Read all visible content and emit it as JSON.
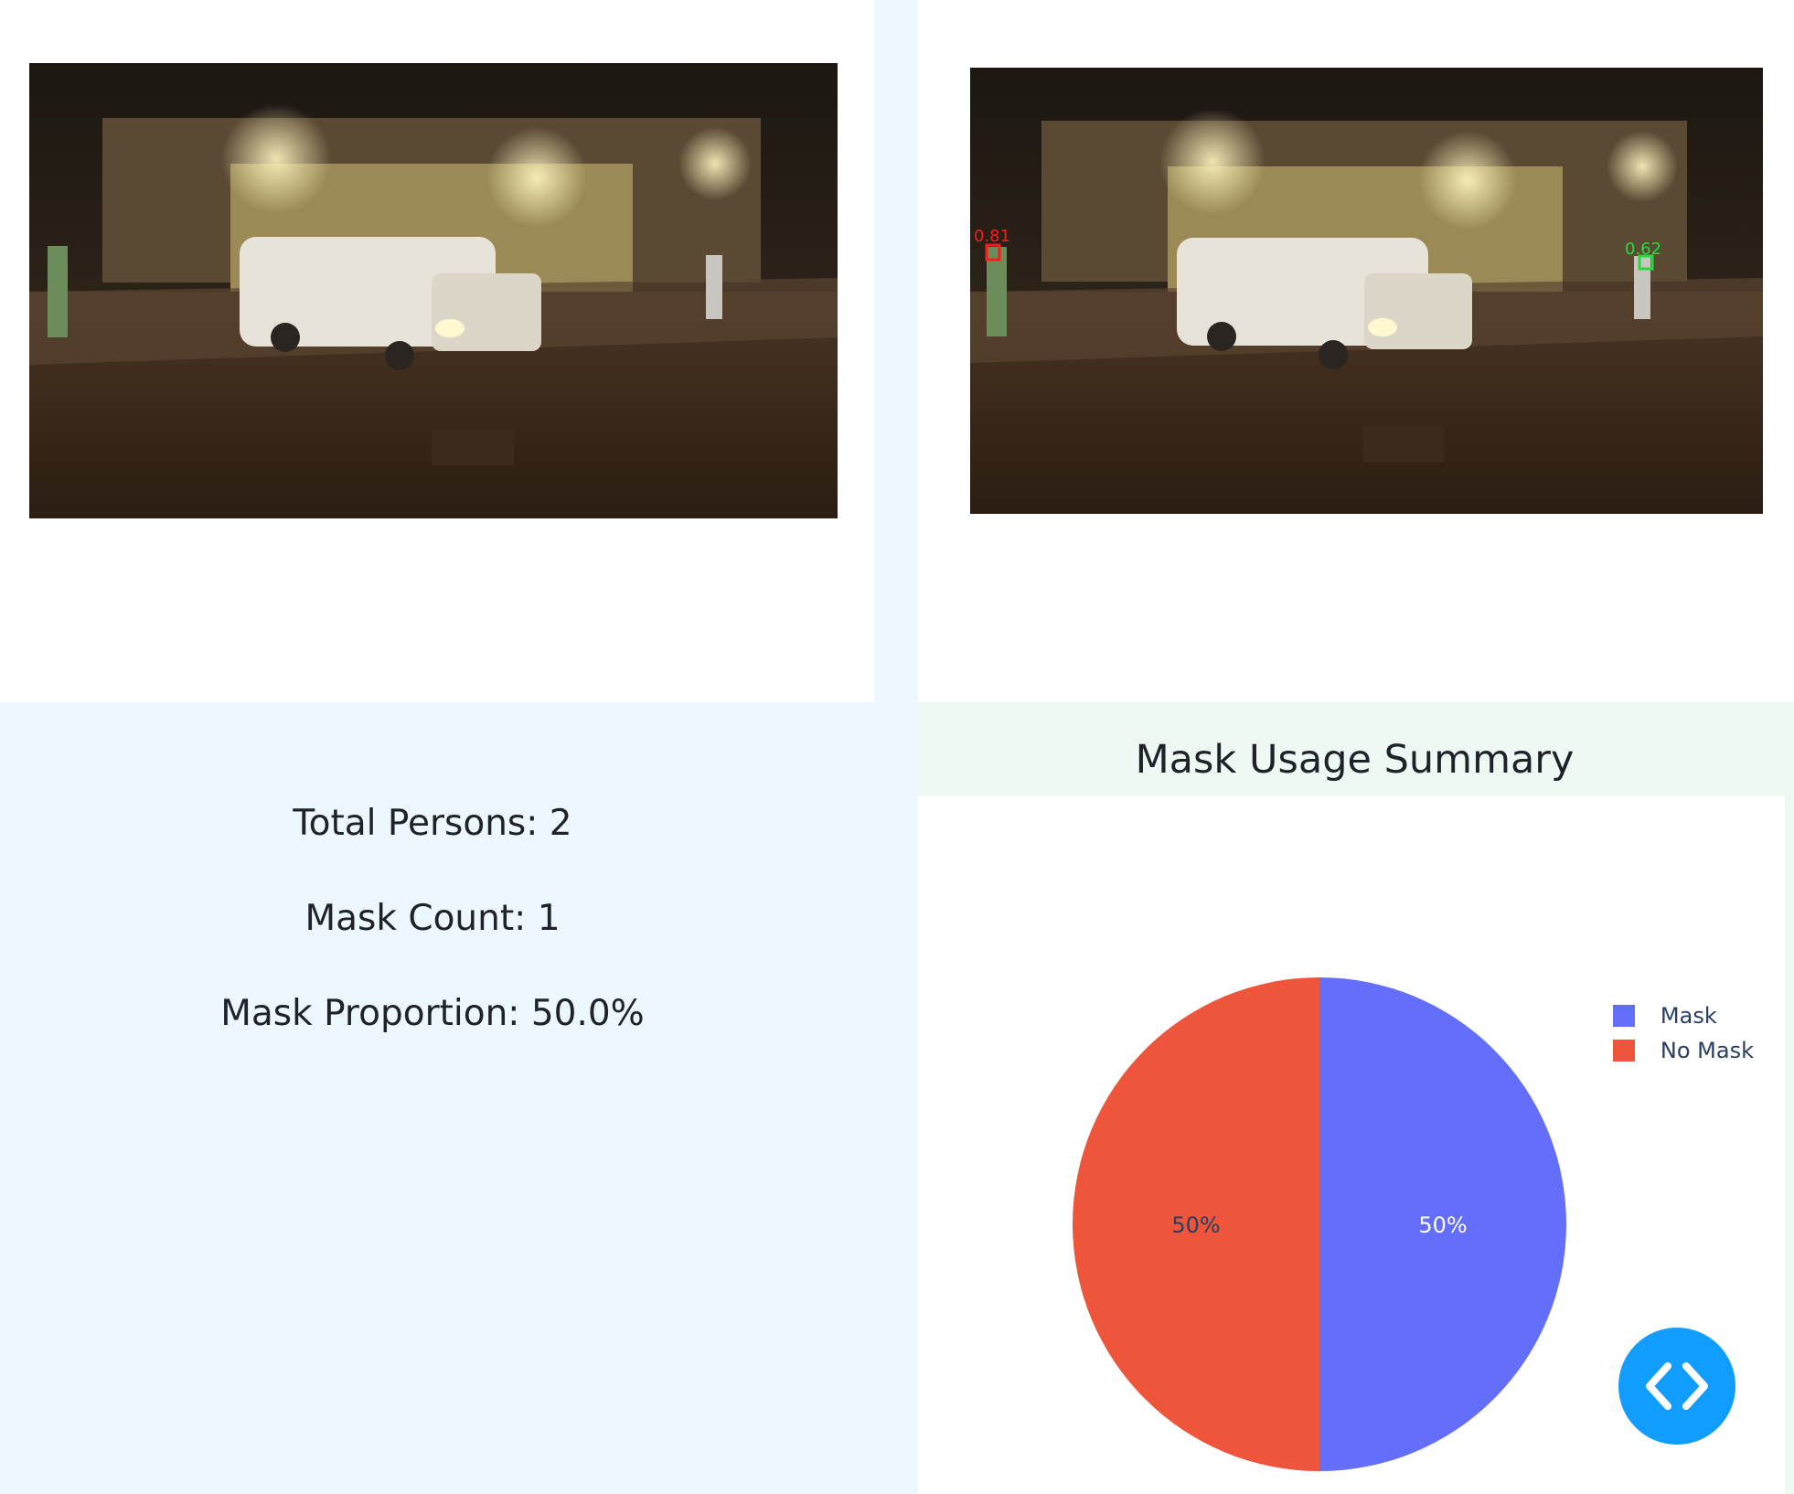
{
  "images": {
    "original": {
      "alt": "street-scene"
    },
    "detected": {
      "alt": "street-scene-with-detections",
      "detections": [
        {
          "label": "0.81",
          "color": "#ff1a1a"
        },
        {
          "label": "0.62",
          "color": "#27d93a"
        }
      ]
    }
  },
  "stats": {
    "total_persons": "Total Persons: 2",
    "mask_count": "Mask Count: 1",
    "mask_proportion": "Mask Proportion: 50.0%"
  },
  "chart": {
    "title": "Mask Usage Summary",
    "legend": [
      {
        "label": "Mask",
        "color": "#636efa"
      },
      {
        "label": "No Mask",
        "color": "#ef553b"
      }
    ]
  },
  "chart_data": {
    "type": "pie",
    "title": "Mask Usage Summary",
    "labels": [
      "Mask",
      "No Mask"
    ],
    "values": [
      1,
      1
    ],
    "text_labels": [
      "50%",
      "50%"
    ],
    "colors": [
      "#636efa",
      "#ef553b"
    ],
    "legend_position": "top-right"
  },
  "controls": {
    "code_toggle_icon": "code-brackets-icon"
  }
}
